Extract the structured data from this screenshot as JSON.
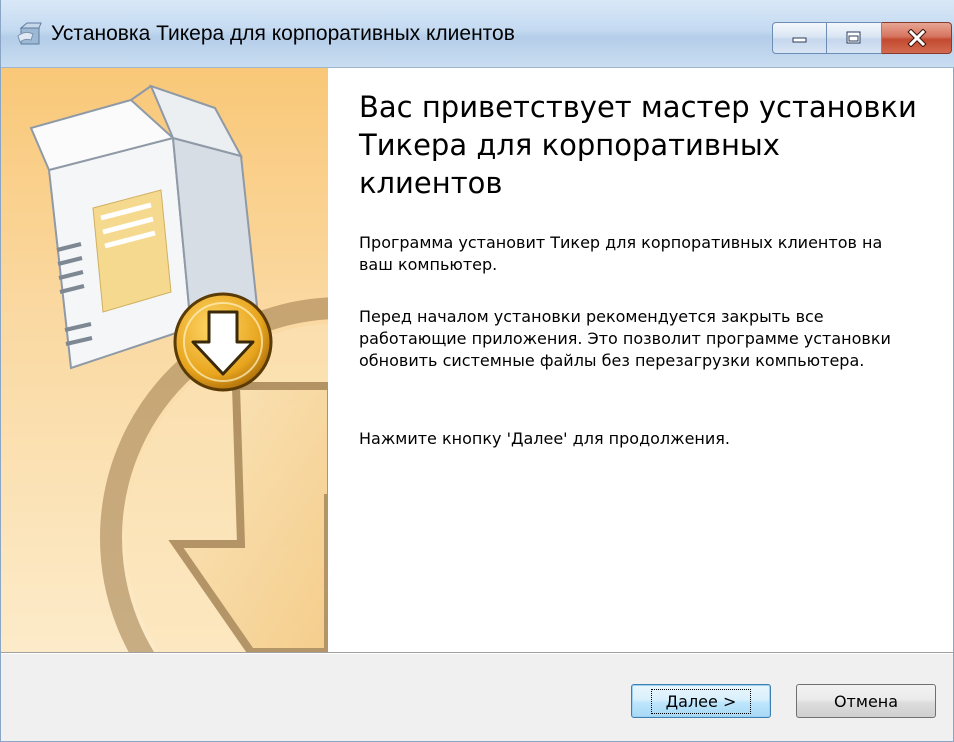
{
  "window": {
    "title": "Установка Тикера для корпоративных клиентов",
    "controls": {
      "minimize": "minimize-icon",
      "maximize": "maximize-icon",
      "close": "close-icon"
    }
  },
  "main": {
    "heading": "Вас приветствует мастер установки Тикера для корпоративных клиентов",
    "paragraphs": [
      "Программа установит Тикер для корпоративных клиентов на ваш компьютер.",
      "Перед началом установки рекомендуется закрыть все работающие приложения. Это позволит программе установки обновить системные файлы без перезагрузки компьютера.",
      "Нажмите кнопку 'Далее' для продолжения."
    ]
  },
  "buttons": {
    "next": "Далее >",
    "cancel": "Отмена"
  },
  "colors": {
    "panel_top": "#f9c878",
    "panel_bottom": "#fcebc9",
    "close_button": "#c24a30",
    "default_button_border": "#3c7fb1"
  }
}
